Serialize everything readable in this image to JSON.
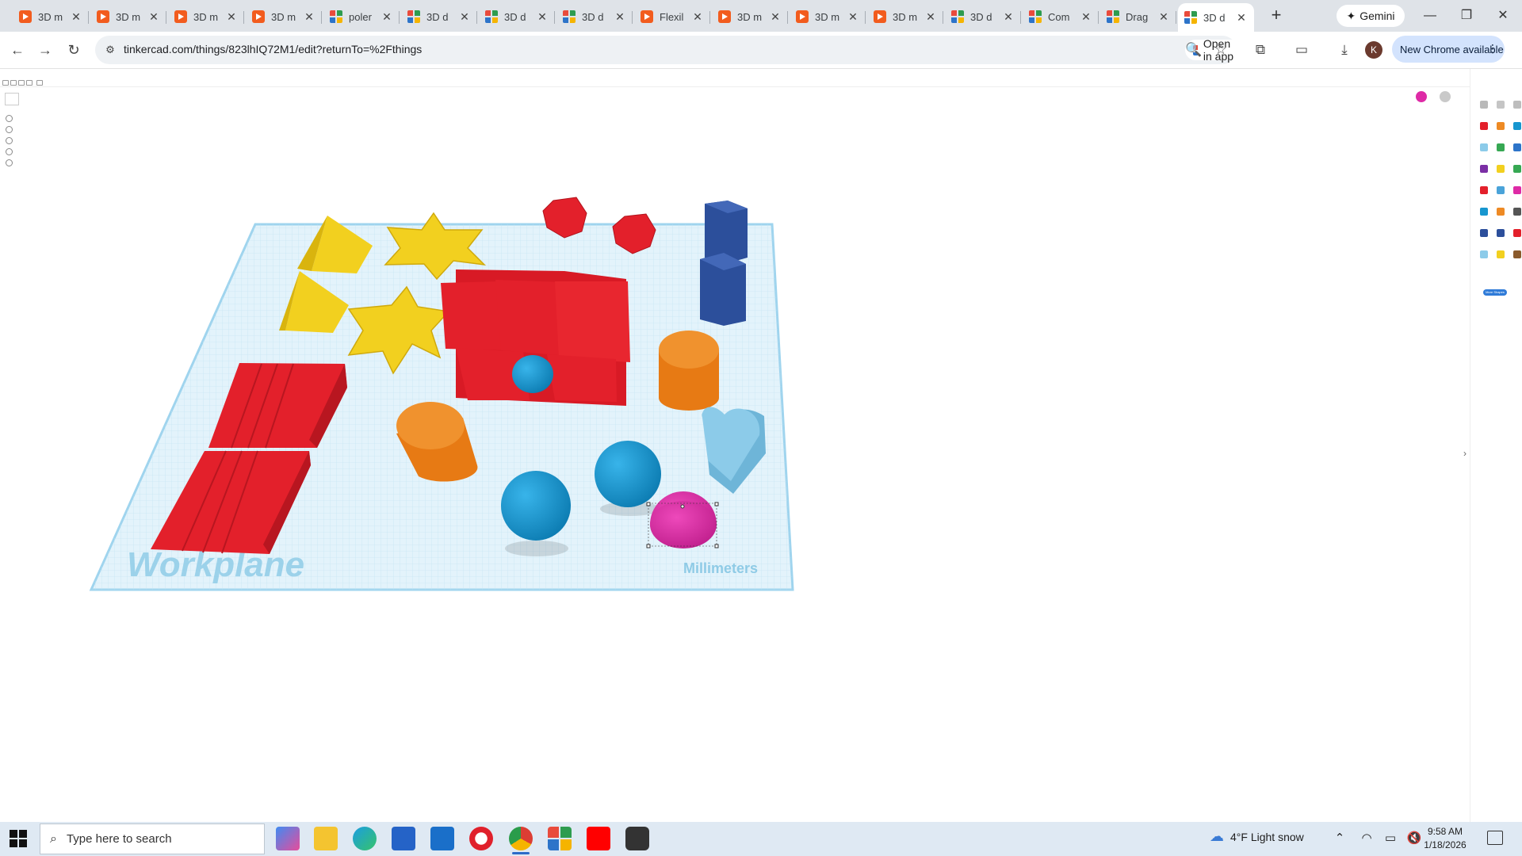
{
  "browser": {
    "tabs": [
      {
        "title": "3D m",
        "icon": "youtube-favicon"
      },
      {
        "title": "3D m",
        "icon": "youtube-favicon"
      },
      {
        "title": "3D m",
        "icon": "youtube-favicon"
      },
      {
        "title": "3D m",
        "icon": "youtube-favicon"
      },
      {
        "title": "poler",
        "icon": "tinkercad-favicon"
      },
      {
        "title": "3D d",
        "icon": "tinkercad-favicon"
      },
      {
        "title": "3D d",
        "icon": "tinkercad-favicon"
      },
      {
        "title": "3D d",
        "icon": "tinkercad-favicon"
      },
      {
        "title": "Flexil",
        "icon": "youtube-favicon"
      },
      {
        "title": "3D m",
        "icon": "youtube-favicon"
      },
      {
        "title": "3D m",
        "icon": "youtube-favicon"
      },
      {
        "title": "3D m",
        "icon": "youtube-favicon"
      },
      {
        "title": "3D d",
        "icon": "tinkercad-favicon"
      },
      {
        "title": "Com",
        "icon": "tinkercad-favicon"
      },
      {
        "title": "Drag",
        "icon": "tinkercad-favicon"
      },
      {
        "title": "3D d",
        "icon": "tinkercad-favicon",
        "active": true
      }
    ],
    "new_tab_label": "+",
    "gemini_label": "Gemini",
    "url": "tinkercad.com/things/823lhIQ72M1/edit?returnTo=%2Fthings",
    "open_in_app_label": "Open in app",
    "profile_initial": "K",
    "update_label": "New Chrome available"
  },
  "workplane": {
    "label": "Workplane",
    "units_label": "Millimeters",
    "selected_shape": "pink-sphere",
    "shape_colors": {
      "red": "#e3202b",
      "yellow": "#f2d01f",
      "blue": "#1796cf",
      "navy": "#2c4f9b",
      "orange": "#ee8a24",
      "light_blue": "#8ccbe9",
      "pink": "#de2aa6"
    },
    "grid_color": "#9fd4ee"
  },
  "taskbar": {
    "search_placeholder": "Type here to search",
    "weather": "4°F  Light snow",
    "time": "9:58 AM",
    "date": "1/18/2026"
  }
}
